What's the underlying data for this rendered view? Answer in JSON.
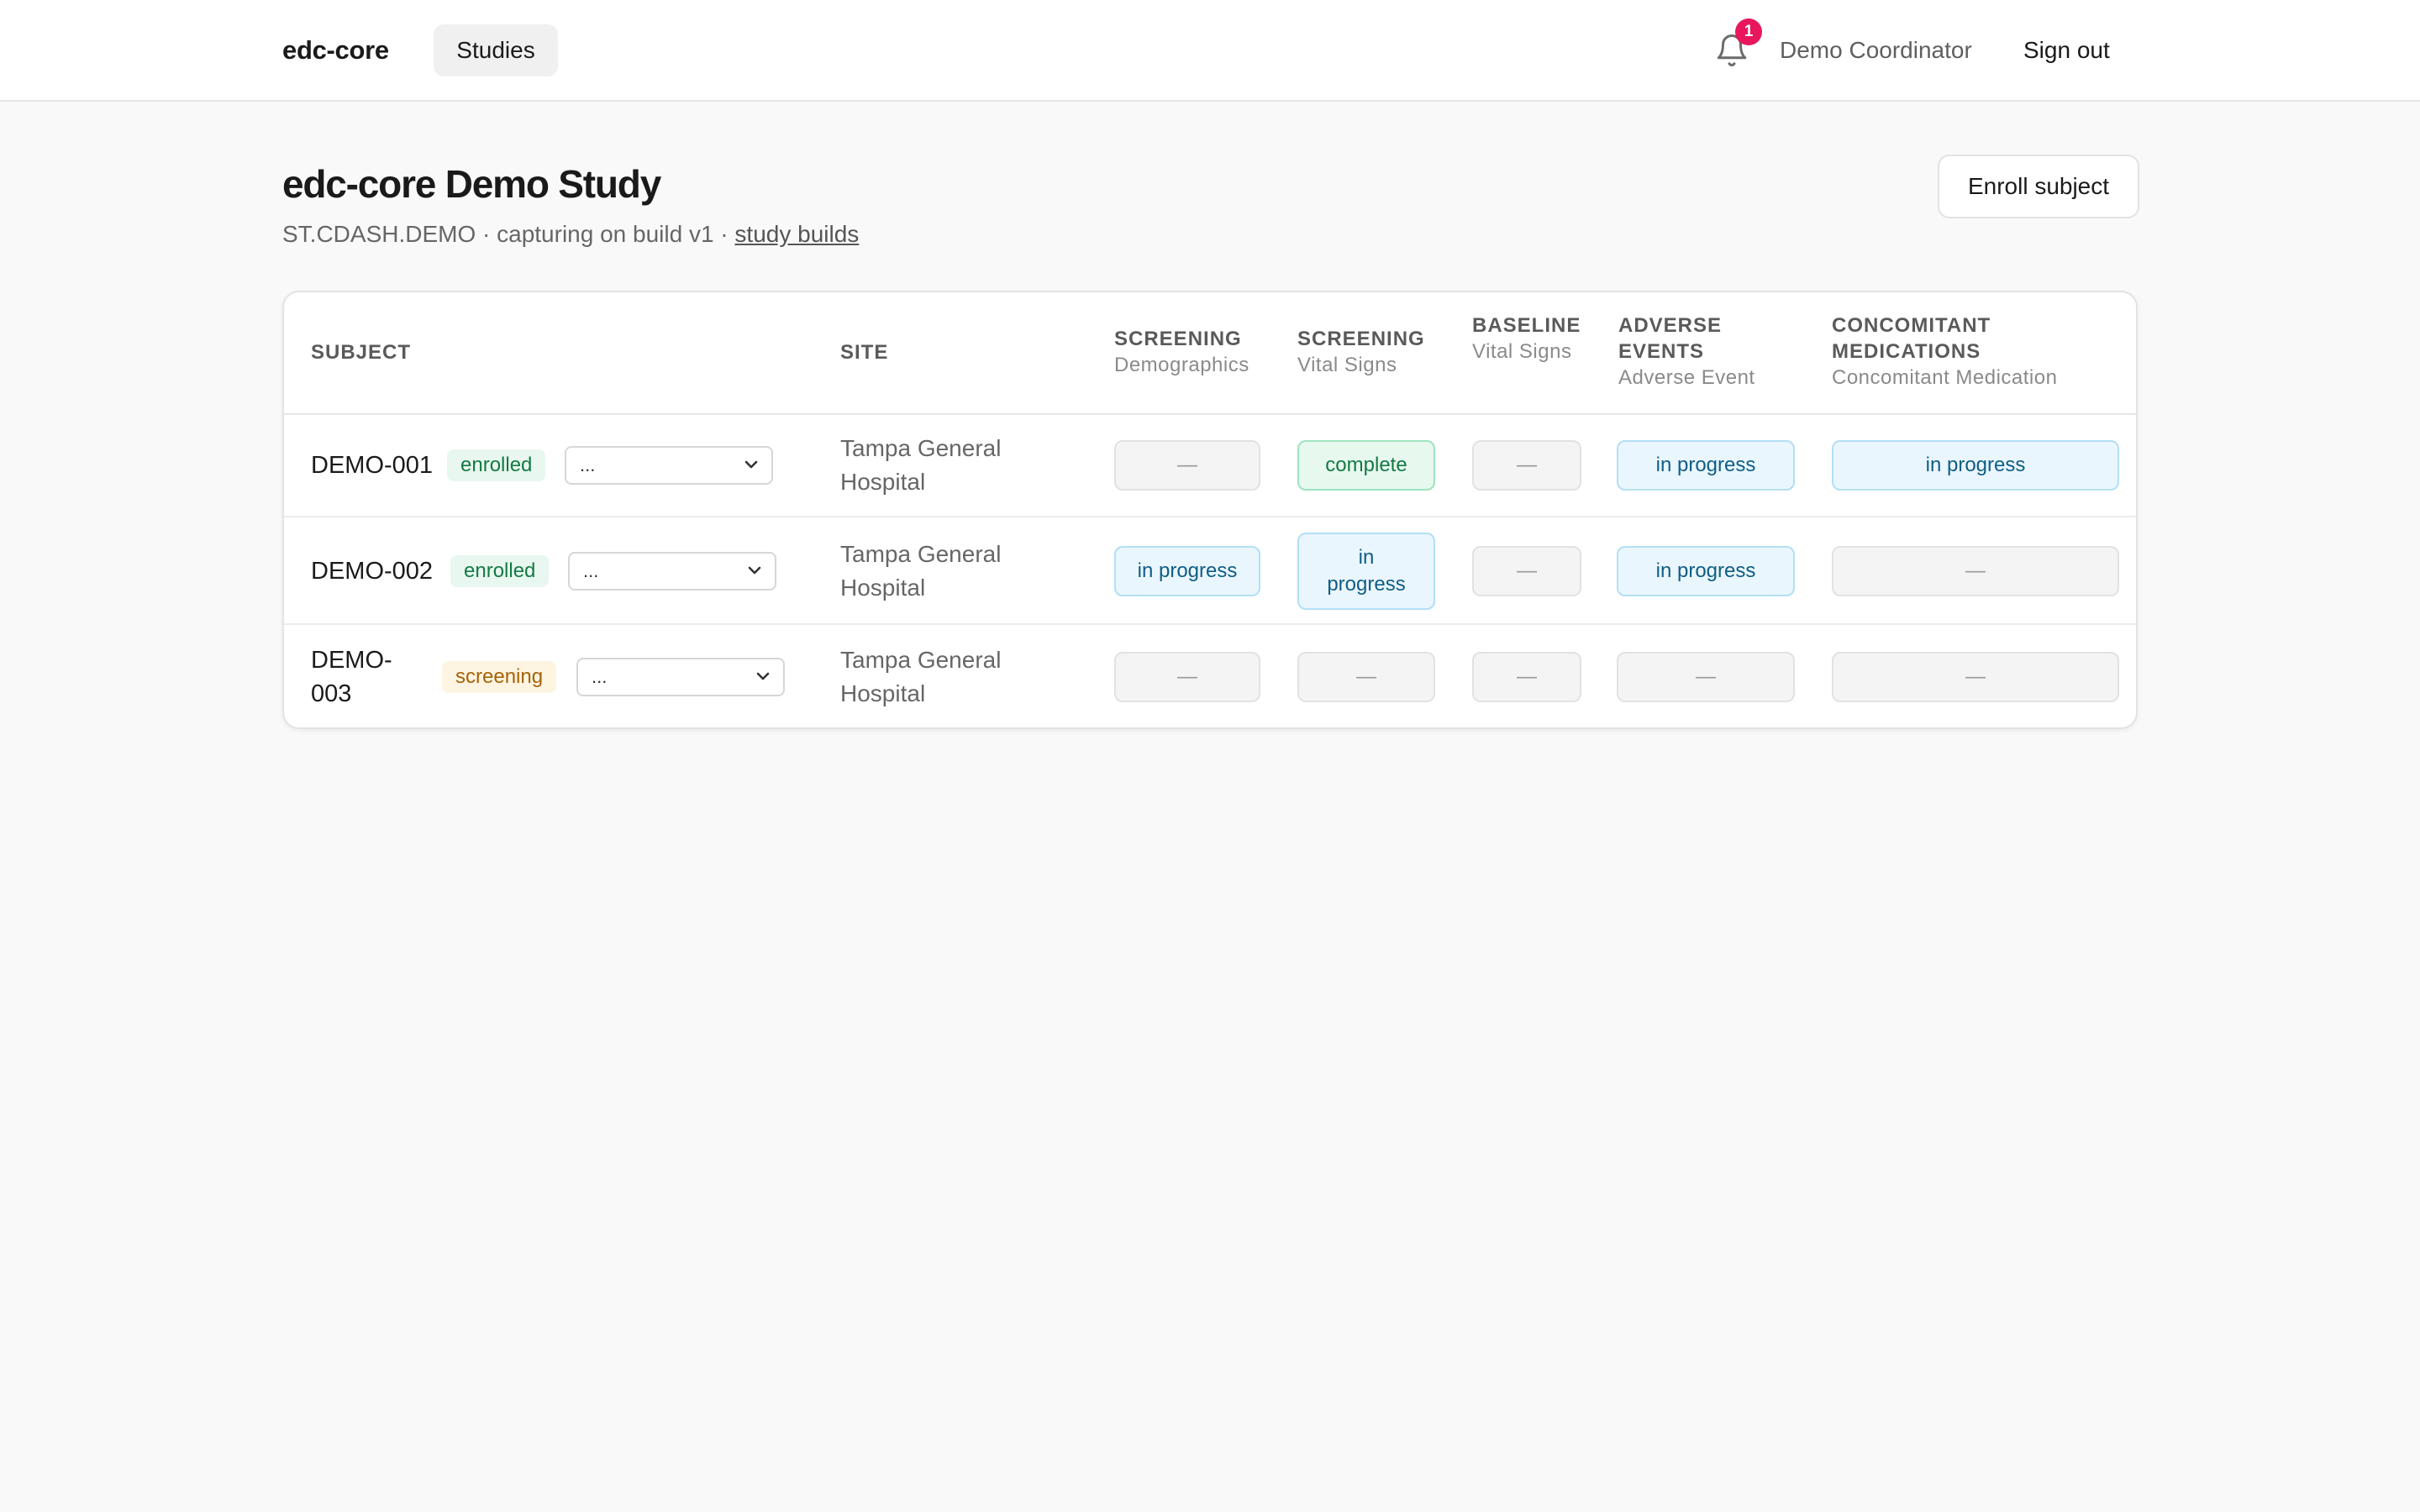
{
  "nav": {
    "brand": "edc-core",
    "studies_label": "Studies",
    "notification_count": "1",
    "user_name": "Demo Coordinator",
    "signout_label": "Sign out"
  },
  "page": {
    "title": "edc-core Demo Study",
    "subtitle_prefix": "ST.CDASH.DEMO · capturing on build v1 · ",
    "subtitle_link": "study builds",
    "enroll_label": "Enroll subject"
  },
  "table": {
    "headers": {
      "subject": "SUBJECT",
      "site": "SITE",
      "col1": {
        "title": "SCREENING",
        "sub": "Demographics"
      },
      "col2": {
        "title": "SCREENING",
        "sub": "Vital Signs"
      },
      "col3": {
        "title": "BASELINE",
        "sub": "Vital Signs"
      },
      "col4": {
        "title": "ADVERSE EVENTS",
        "sub": "Adverse Event"
      },
      "col5": {
        "title": "CONCOMITANT MEDICATIONS",
        "sub": "Concomitant Medication"
      }
    },
    "rows": [
      {
        "id": "DEMO-001",
        "status": "enrolled",
        "select": "...",
        "site": "Tampa General Hospital",
        "cells": [
          "—",
          "complete",
          "—",
          "in progress",
          "in progress"
        ]
      },
      {
        "id": "DEMO-002",
        "status": "enrolled",
        "select": "...",
        "site": "Tampa General Hospital",
        "cells": [
          "in progress",
          "in progress",
          "—",
          "in progress",
          "—"
        ]
      },
      {
        "id": "DEMO-003",
        "status": "screening",
        "select": "...",
        "site": "Tampa General Hospital",
        "cells": [
          "—",
          "—",
          "—",
          "—",
          "—"
        ]
      }
    ]
  },
  "colors": {
    "accent_badge": "#e8175d",
    "enrolled": "#147a43",
    "screening": "#a86207",
    "in_progress": "#0f5d86"
  }
}
